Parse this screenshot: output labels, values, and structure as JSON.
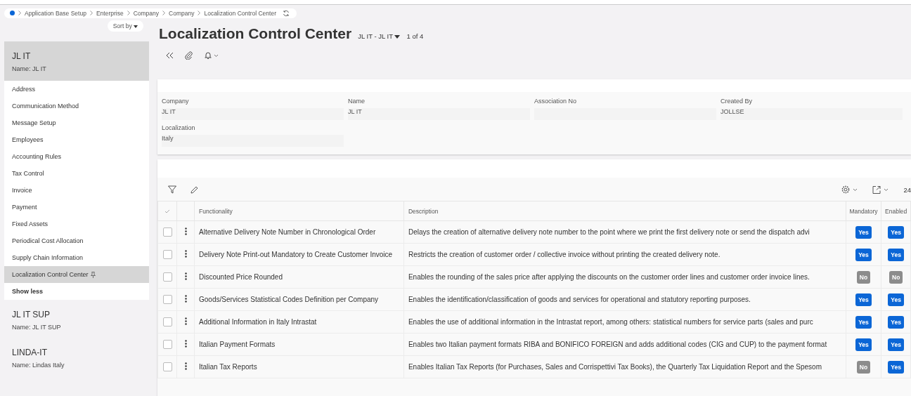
{
  "breadcrumb": [
    "Application Base Setup",
    "Enterprise",
    "Company",
    "Company",
    "Localization Control Center"
  ],
  "sidebar": {
    "sort_label": "Sort by",
    "records": [
      {
        "title": "JL IT",
        "name_label": "Name:",
        "name": "JL IT",
        "selected": true,
        "links": [
          {
            "label": "Address",
            "selected": false
          },
          {
            "label": "Communication Method",
            "selected": false
          },
          {
            "label": "Message Setup",
            "selected": false
          },
          {
            "label": "Employees",
            "selected": false
          },
          {
            "label": "Accounting Rules",
            "selected": false
          },
          {
            "label": "Tax Control",
            "selected": false
          },
          {
            "label": "Invoice",
            "selected": false
          },
          {
            "label": "Payment",
            "selected": false
          },
          {
            "label": "Fixed Assets",
            "selected": false
          },
          {
            "label": "Periodical Cost Allocation",
            "selected": false
          },
          {
            "label": "Supply Chain Information",
            "selected": false
          },
          {
            "label": "Localization Control Center",
            "selected": true
          }
        ],
        "show_less": "Show less"
      },
      {
        "title": "JL IT SUP",
        "name_label": "Name:",
        "name": "JL IT SUP",
        "selected": false
      },
      {
        "title": "LINDA-IT",
        "name_label": "Name:",
        "name": "Lindas Italy",
        "selected": false
      }
    ]
  },
  "page": {
    "title": "Localization Control Center",
    "record_selector": "JL IT - JL IT",
    "position": "1 of 4"
  },
  "details": [
    {
      "label": "Company",
      "value": "JL IT"
    },
    {
      "label": "Name",
      "value": "JL IT"
    },
    {
      "label": "Association No"
    },
    {
      "label": "Created By",
      "value": "JOLLSE"
    },
    {
      "label": "Localization",
      "value": "Italy"
    }
  ],
  "table": {
    "count": "24",
    "columns": [
      "Functionality",
      "Description",
      "Mandatory",
      "Enabled"
    ],
    "rows": [
      {
        "checked": false,
        "functionality": "Alternative Delivery Note Number in Chronological Order",
        "description": "Delays the creation of alternative delivery note number to the point where we print the first delivery note or send the dispatch advi",
        "mandatory": {
          "text": "Yes",
          "on": true
        },
        "enabled": {
          "text": "Yes",
          "on": true
        }
      },
      {
        "checked": false,
        "functionality": "Delivery Note Print-out Mandatory to Create Customer Invoice",
        "description": "Restricts the creation of customer order / collective invoice without printing the created delivery note.",
        "mandatory": {
          "text": "Yes",
          "on": true
        },
        "enabled": {
          "text": "Yes",
          "on": true
        }
      },
      {
        "checked": false,
        "functionality": "Discounted Price Rounded",
        "description": "Enables the rounding of the sales price after applying the discounts on the customer order lines and customer order invoice lines.",
        "mandatory": {
          "text": "No",
          "on": false
        },
        "enabled": {
          "text": "No",
          "on": false
        }
      },
      {
        "checked": false,
        "functionality": "Goods/Services Statistical Codes Definition per Company",
        "description": "Enables the identification/classification of goods and services for operational and statutory reporting purposes.",
        "mandatory": {
          "text": "Yes",
          "on": true
        },
        "enabled": {
          "text": "Yes",
          "on": true
        }
      },
      {
        "checked": false,
        "functionality": "Additional Information in Italy Intrastat",
        "description": "Enables the use of additional information in the Intrastat report, among others: statistical numbers for service parts (sales and purc",
        "mandatory": {
          "text": "Yes",
          "on": true
        },
        "enabled": {
          "text": "Yes",
          "on": true
        }
      },
      {
        "checked": false,
        "functionality": "Italian Payment Formats",
        "description": "Enables two Italian payment formats RIBA and BONIFICO FOREIGN and adds additional codes (CIG and CUP) to the payment format",
        "mandatory": {
          "text": "Yes",
          "on": true
        },
        "enabled": {
          "text": "Yes",
          "on": true
        }
      },
      {
        "checked": false,
        "functionality": "Italian Tax Reports",
        "description": "Enables Italian Tax Reports (for Purchases, Sales and Corrispettivi Tax Books), the Quarterly Tax Liquidation Report and the Spesom",
        "mandatory": {
          "text": "No",
          "on": false
        },
        "enabled": {
          "text": "Yes",
          "on": true
        }
      }
    ]
  }
}
